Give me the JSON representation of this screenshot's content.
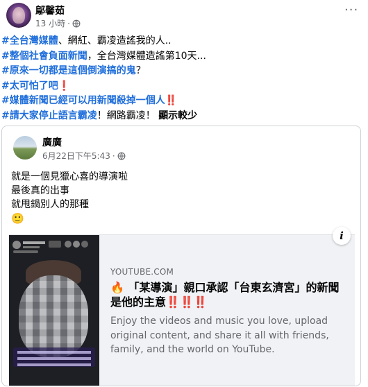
{
  "post": {
    "author": "鄔馨茹",
    "time": "13 小時",
    "separator": "·",
    "privacy_icon": "globe-icon",
    "more_icon": "more-horizontal-icon",
    "lines": [
      [
        {
          "type": "tag",
          "text": "#全台灣媒體"
        },
        {
          "type": "plain",
          "text": "、網紅、霸凌造謠我的人.."
        }
      ],
      [
        {
          "type": "tag",
          "text": "#整個社會負面新聞"
        },
        {
          "type": "plain",
          "text": "，全台灣媒體造謠第10天..."
        }
      ],
      [
        {
          "type": "tag",
          "text": "#原來一切都是這個倒演搞的鬼"
        },
        {
          "type": "plain",
          "text": "？"
        }
      ],
      [
        {
          "type": "tag",
          "text": "#太可怕了吧"
        },
        {
          "type": "red",
          "text": "❗"
        }
      ],
      [
        {
          "type": "tag",
          "text": "#媒體新聞已經可以用新聞殺掉一個人"
        },
        {
          "type": "red",
          "text": "‼️"
        }
      ],
      [
        {
          "type": "tag",
          "text": "#請大家停止語言霸凌"
        },
        {
          "type": "plain",
          "text": "！網路霸凌！ "
        },
        {
          "type": "seemore",
          "text": "顯示較少"
        }
      ]
    ]
  },
  "shared_post": {
    "author": "廣廣",
    "time": "6月22日下午5:43",
    "separator": "·",
    "privacy_icon": "globe-icon",
    "text_lines": [
      "就是一個見獵心喜的導演啦",
      "最後真的出事",
      "就甩鍋別人的那種"
    ],
    "emoji": "🙂"
  },
  "link_preview": {
    "domain": "YOUTUBE.COM",
    "title_prefix": "🔥",
    "title": " 「某導演」親口承認「台東玄濟宮」的新聞是他的主意",
    "title_suffix": "‼️‼️‼️",
    "description": "Enjoy the videos and music you love, upload original content, and share it all with friends, family, and the world on YouTube.",
    "info_icon": "i"
  },
  "colors": {
    "hashtag": "#216fdb",
    "secondary_text": "#65676b",
    "card_background": "#f0f2f5",
    "emphasis_red": "#e0232e"
  }
}
